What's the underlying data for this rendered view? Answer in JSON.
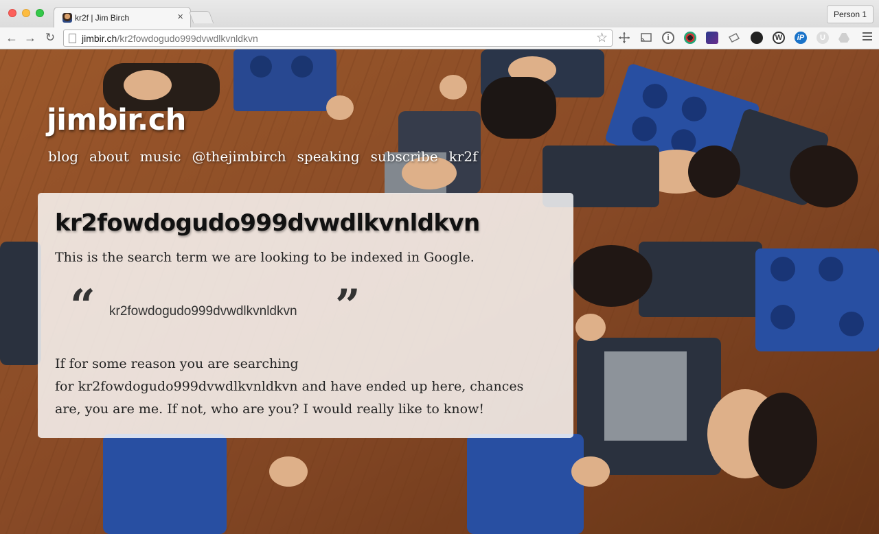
{
  "browser": {
    "tab_title": "kr2f | Jim Birch",
    "tab_close": "×",
    "profile_label": "Person 1",
    "url_host": "jimbir.ch",
    "url_path": "/kr2fowdogudo999dvwdlkvnldkvn",
    "extension_glyphs": {
      "info": "i",
      "wordpress": "W",
      "instapaper": "iP",
      "ublock": "U"
    }
  },
  "site": {
    "title": "jimbir.ch",
    "nav": [
      "blog",
      "about",
      "music",
      "@thejimbirch",
      "speaking",
      "subscribe",
      "kr2f"
    ]
  },
  "article": {
    "heading": "kr2fowdogudo999dvwdlkvnldkvn",
    "lede": "This is the search term we are looking to be indexed in Google.",
    "quote_open": "“",
    "quote": "kr2fowdogudo999dvwdlkvnldkvn",
    "quote_close": "”",
    "body_lines": [
      "If for some reason you are searching",
      "for kr2fowdogudo999dvwdlkvnldkvn and have ended up here, chances",
      "are, you are me.  If not, who are you?  I would really like to know!"
    ]
  }
}
